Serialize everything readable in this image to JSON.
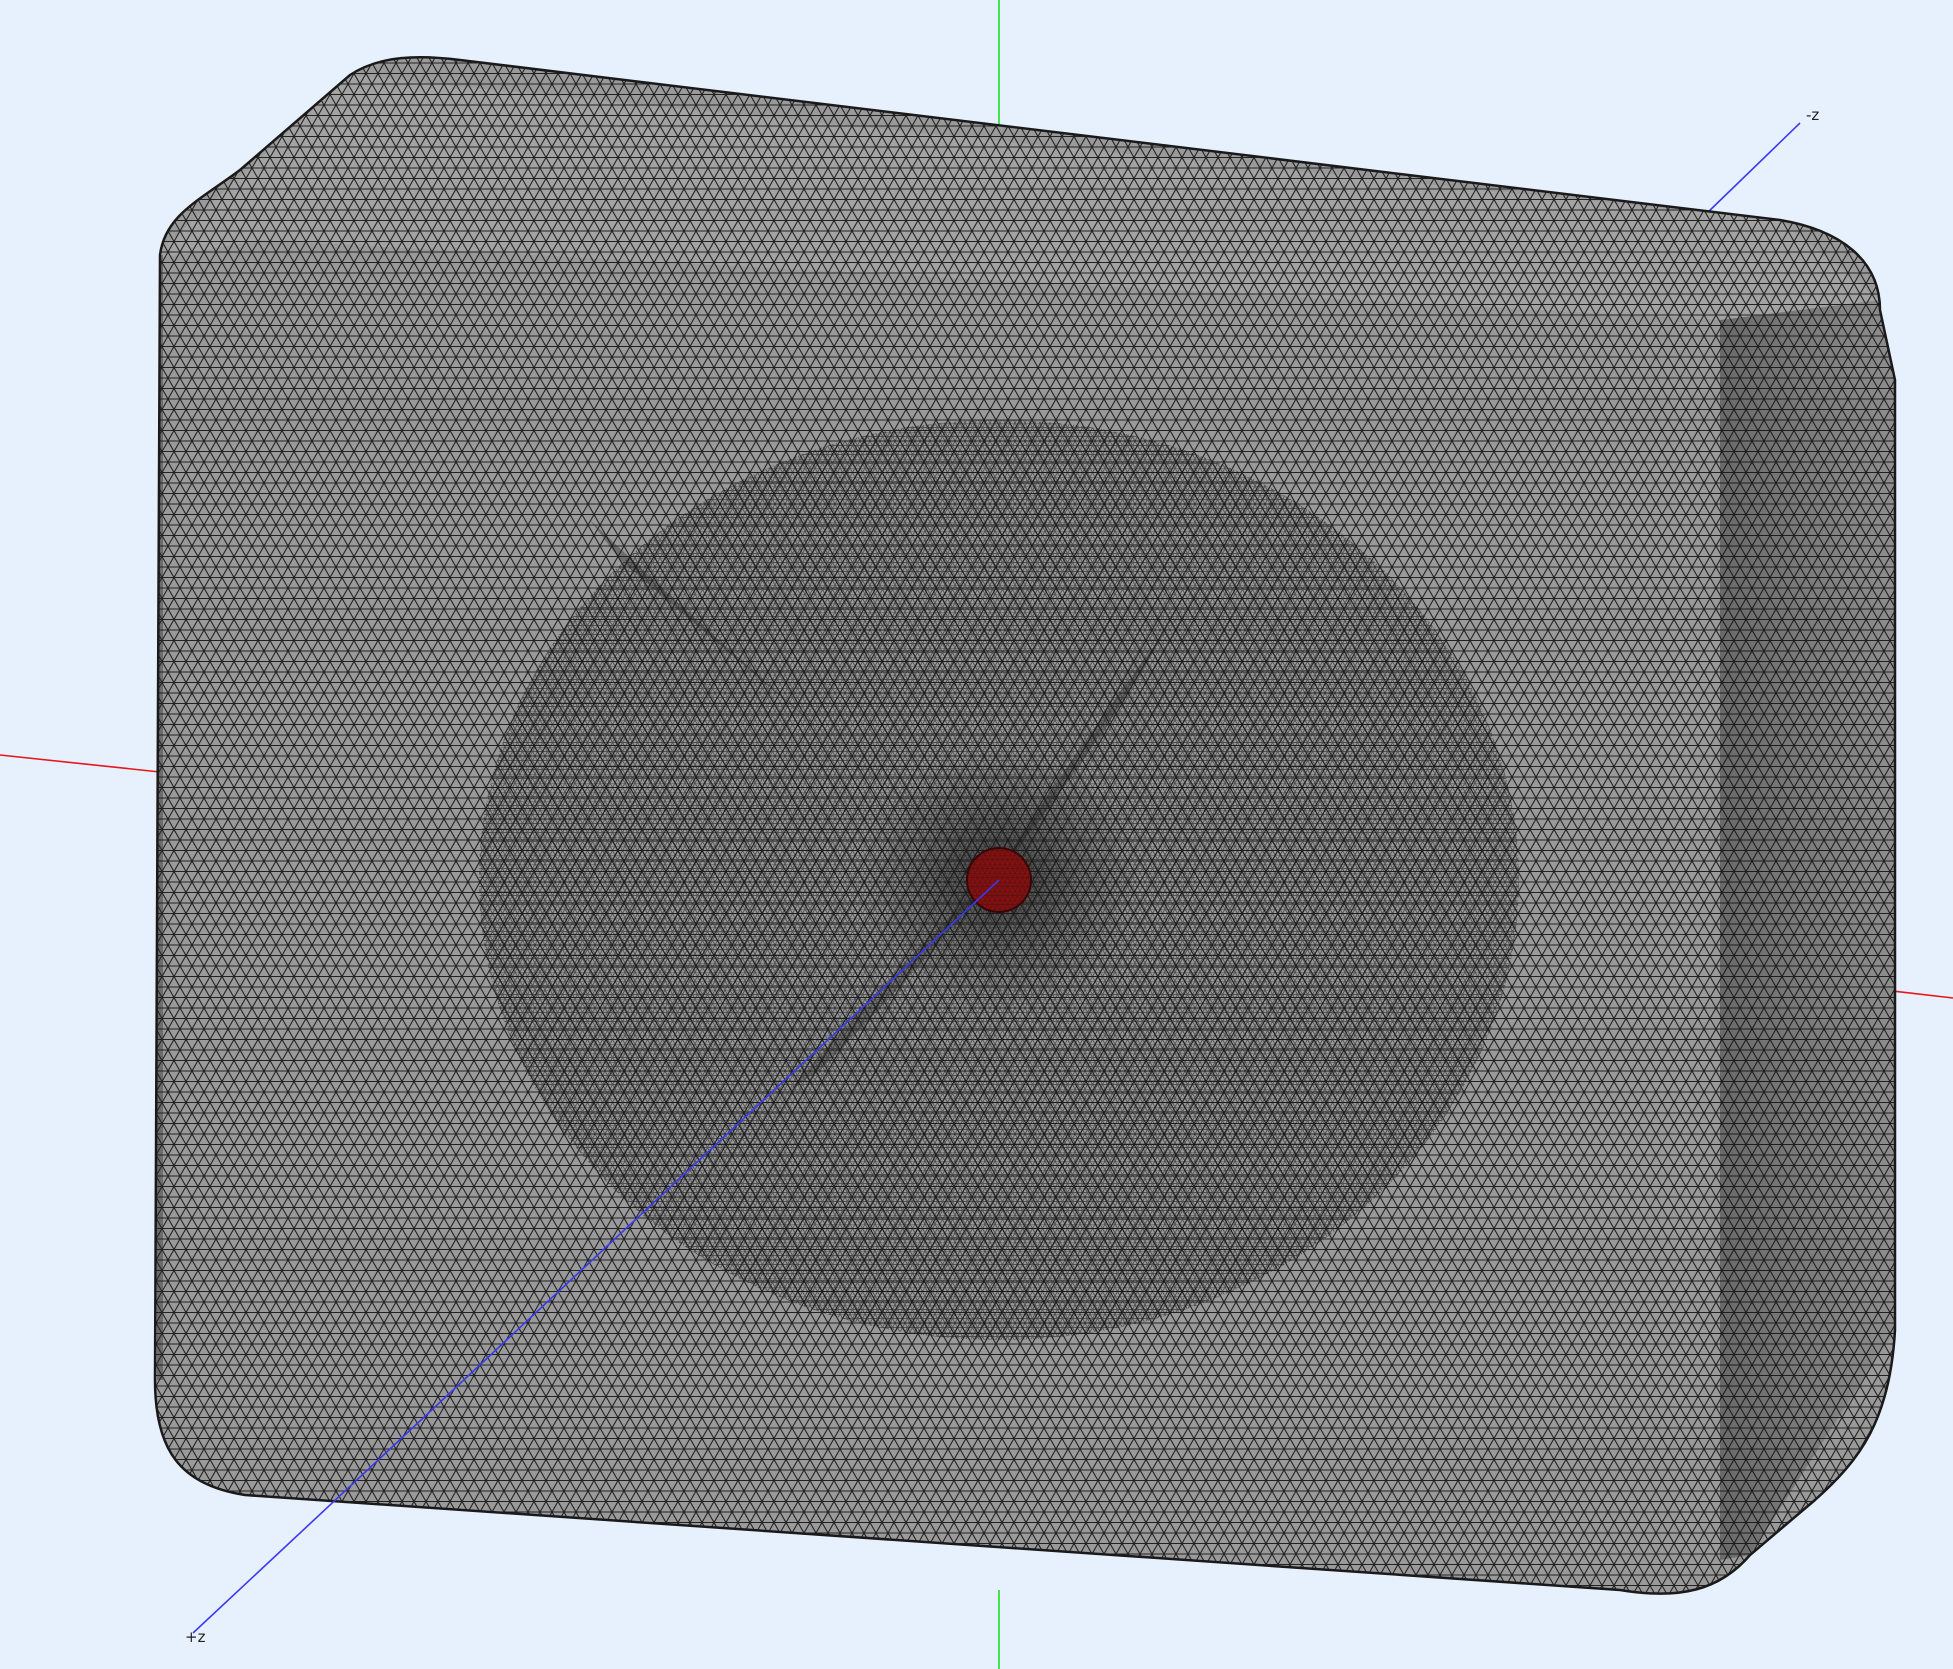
{
  "viewport": {
    "background": "#e6f1fd",
    "mesh_fill": "#9a9a9a",
    "mesh_line": "#141414",
    "hole_color": "#8a1010"
  },
  "axes": {
    "x": {
      "color": "#e8151b"
    },
    "y": {
      "color": "#1ee11e"
    },
    "z": {
      "color": "#3a3af0"
    }
  },
  "labels": {
    "neg_z": "-z",
    "pos_z": "+z"
  }
}
